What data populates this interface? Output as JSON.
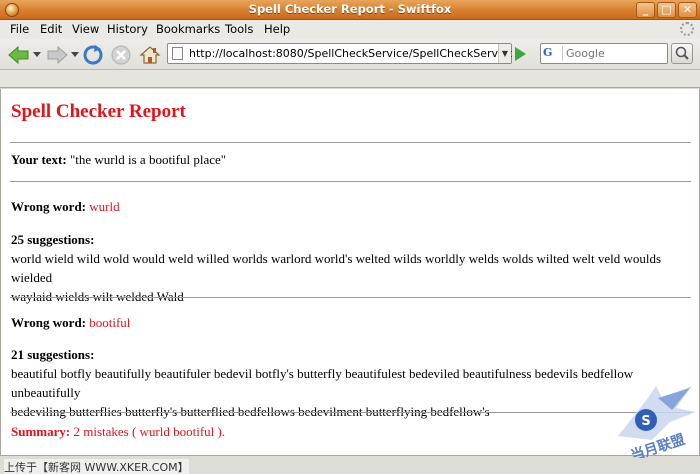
{
  "window": {
    "title": "Spell Checker Report - Swiftfox",
    "controls": [
      "_",
      "□",
      "✕"
    ]
  },
  "menu": {
    "items": [
      "File",
      "Edit",
      "View",
      "History",
      "Bookmarks",
      "Tools",
      "Help"
    ]
  },
  "navigation": {
    "url": "http://localhost:8080/SpellCheckService/SpellCheckServlet",
    "search_placeholder": "Google",
    "search_engine_letter": "G"
  },
  "report": {
    "title": "Spell Checker Report",
    "your_text_label": "Your text:",
    "your_text_value": "\"the wurld is a bootiful place\"",
    "wrong_word_label": "Wrong word:",
    "entries": [
      {
        "word": "wurld",
        "suggestions_label": "25 suggestions:",
        "suggestions_line1": "world wield wild wold would weld willed worlds warlord world's welted wilds worldly welds wolds wilted welt veld woulds wielded",
        "suggestions_line2": "waylaid wields wilt welded Wald"
      },
      {
        "word": "bootiful",
        "suggestions_label": "21 suggestions:",
        "suggestions_line1": "beautiful botfly beautifully beautifuler bedevil botfly's butterfly beautifulest bedeviled beautifulness bedevils bedfellow unbeautifully",
        "suggestions_line2": "bedeviling butterflies butterfly's butterflied bedfellows bedevilment butterflying bedfellow's"
      }
    ],
    "summary_label": "Summary:",
    "summary_value": "2 mistakes ( wurld bootiful )."
  },
  "status": {
    "text": "上传于【新客网 WWW.XKER.COM】"
  },
  "watermark": {
    "text": "当月联盟"
  },
  "colors": {
    "accent_red": "#e3141c",
    "titlebar_orange": "#d77f2f"
  }
}
